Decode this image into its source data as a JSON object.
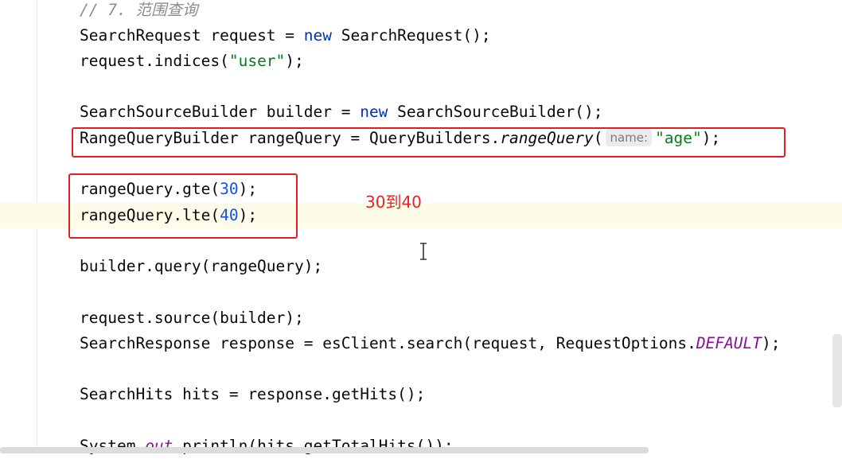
{
  "code": {
    "line1": {
      "comment": "// 7. 范围查询"
    },
    "line2": {
      "type": "SearchRequest",
      "rest1": " request = ",
      "kw": "new",
      "rest2": " SearchRequest();"
    },
    "line3": {
      "pre": "request.indices(",
      "str": "\"user\"",
      "post": ");"
    },
    "line5": {
      "type": "SearchSourceBuilder",
      "rest1": " builder = ",
      "kw": "new",
      "rest2": " SearchSourceBuilder();"
    },
    "line6": {
      "pre": "RangeQueryBuilder rangeQuery = QueryBuilders.",
      "method": "rangeQuery",
      "paren": "(",
      "hint": "name:",
      "str": "\"age\"",
      "post": ");"
    },
    "line8": {
      "pre": "rangeQuery.gte(",
      "num": "30",
      "post": ");"
    },
    "line9": {
      "pre": "rangeQuery.lte(",
      "num": "40",
      "post": ");"
    },
    "line11": {
      "text": "builder.query(rangeQuery);"
    },
    "line13": {
      "text": "request.source(builder);"
    },
    "line14": {
      "pre": "SearchResponse response = esClient.search(request, RequestOptions.",
      "static": "DEFAULT",
      "post": ");"
    },
    "line16": {
      "text": "SearchHits hits = response.getHits();"
    },
    "line18": {
      "pre": "System.",
      "static": "out",
      "post": ".println(hits.getTotalHits());"
    }
  },
  "annotation": {
    "text": "30到40"
  },
  "colors": {
    "keyword": "#0033b3",
    "string": "#067d17",
    "number": "#1750eb",
    "comment": "#8c8c8c",
    "static_field": "#871094",
    "annotation_red": "#e02020",
    "current_line": "#fdfce9"
  },
  "icons": {
    "cursor": "text-cursor-icon"
  }
}
